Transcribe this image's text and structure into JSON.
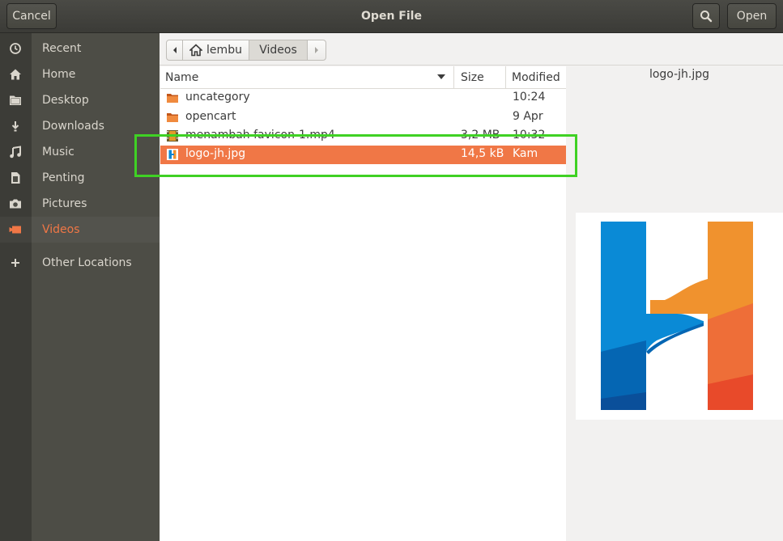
{
  "header": {
    "cancel_label": "Cancel",
    "title": "Open File",
    "open_label": "Open",
    "search_icon": "search-icon"
  },
  "sidebar": {
    "items": [
      {
        "label": "Recent",
        "icon": "clock-icon"
      },
      {
        "label": "Home",
        "icon": "home-icon"
      },
      {
        "label": "Desktop",
        "icon": "folder-icon"
      },
      {
        "label": "Downloads",
        "icon": "download-icon"
      },
      {
        "label": "Music",
        "icon": "music-icon"
      },
      {
        "label": "Penting",
        "icon": "document-icon"
      },
      {
        "label": "Pictures",
        "icon": "camera-icon"
      },
      {
        "label": "Videos",
        "icon": "video-icon",
        "active": true
      },
      {
        "label": "Other Locations",
        "icon": "plus-icon"
      }
    ]
  },
  "pathbar": {
    "home": "lembu",
    "current": "Videos"
  },
  "columns": {
    "name": "Name",
    "size": "Size",
    "modified": "Modified"
  },
  "files": [
    {
      "name": "uncategory",
      "size": "",
      "modified": "10:24",
      "type": "folder"
    },
    {
      "name": "opencart",
      "size": "",
      "modified": "9 Apr",
      "type": "folder"
    },
    {
      "name": "menambah favicon-1.mp4",
      "size": "3,2 MB",
      "modified": "10:32",
      "type": "video"
    },
    {
      "name": "logo-jh.jpg",
      "size": "14,5 kB",
      "modified": "Kam",
      "type": "image",
      "selected": true
    }
  ],
  "preview": {
    "filename": "logo-jh.jpg"
  },
  "colors": {
    "accent": "#f07746",
    "highlight": "#3fd124",
    "logo_blue": "#0a86d2",
    "logo_orange": "#f0922e"
  }
}
